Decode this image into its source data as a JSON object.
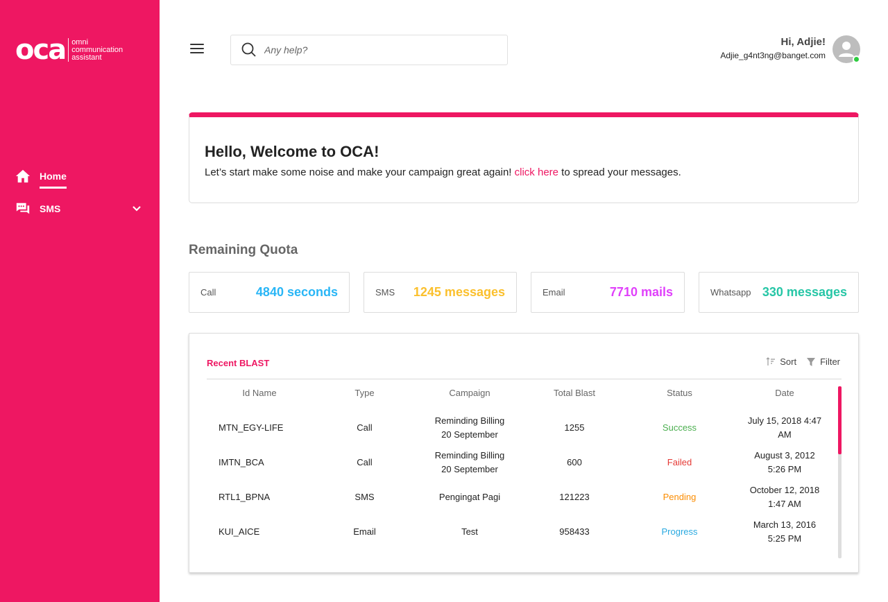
{
  "brand": {
    "logo_mark": "oca",
    "logo_text_1": "omni",
    "logo_text_2": "communication",
    "logo_text_3": "assistant",
    "color": "#ee1762"
  },
  "sidebar": {
    "items": [
      {
        "label": "Home",
        "icon": "home-icon",
        "active": true
      },
      {
        "label": "SMS",
        "icon": "chat-icon",
        "expandable": true
      }
    ]
  },
  "header": {
    "search_placeholder": "Any help?",
    "greeting": "Hi, Adjie!",
    "email": "Adjie_g4nt3ng@banget.com"
  },
  "welcome": {
    "title": "Hello, Welcome to OCA!",
    "text_before": "Let’s start make some noise and make your campaign great again!",
    "link": "click here",
    "text_after": "to spread your messages."
  },
  "quota": {
    "title": "Remaining Quota",
    "items": [
      {
        "label": "Call",
        "value": "4840 seconds",
        "color": "#29b6f6"
      },
      {
        "label": "SMS",
        "value": "1245 messages",
        "color": "#fbc02d"
      },
      {
        "label": "Email",
        "value": "7710 mails",
        "color": "#e040fb"
      },
      {
        "label": "Whatsapp",
        "value": "330 messages",
        "color": "#26c6a6"
      }
    ]
  },
  "blast": {
    "title": "Recent BLAST",
    "sort_label": "Sort",
    "filter_label": "Filter",
    "columns": [
      "Id Name",
      "Type",
      "Campaign",
      "Total Blast",
      "Status",
      "Date"
    ],
    "rows": [
      {
        "id": "MTN_EGY-LIFE",
        "type": "Call",
        "campaign_1": "Reminding Billing",
        "campaign_2": "20 September",
        "total": "1255",
        "status": "Success",
        "status_color": "#4caf50",
        "date_1": "July 15, 2018 4:47",
        "date_2": "AM"
      },
      {
        "id": "IMTN_BCA",
        "type": "Call",
        "campaign_1": "Reminding Billing",
        "campaign_2": "20 September",
        "total": "600",
        "status": "Failed",
        "status_color": "#e53935",
        "date_1": "August 3, 2012",
        "date_2": "5:26 PM"
      },
      {
        "id": "RTL1_BPNA",
        "type": "SMS",
        "campaign_1": "Pengingat Pagi",
        "campaign_2": "",
        "total": "121223",
        "status": "Pending",
        "status_color": "#fb8c00",
        "date_1": "October 12, 2018",
        "date_2": "1:47 AM"
      },
      {
        "id": "KUI_AICE",
        "type": "Email",
        "campaign_1": "Test",
        "campaign_2": "",
        "total": "958433",
        "status": "Progress",
        "status_color": "#29a9e0",
        "date_1": "March 13, 2016",
        "date_2": "5:25 PM"
      }
    ]
  }
}
